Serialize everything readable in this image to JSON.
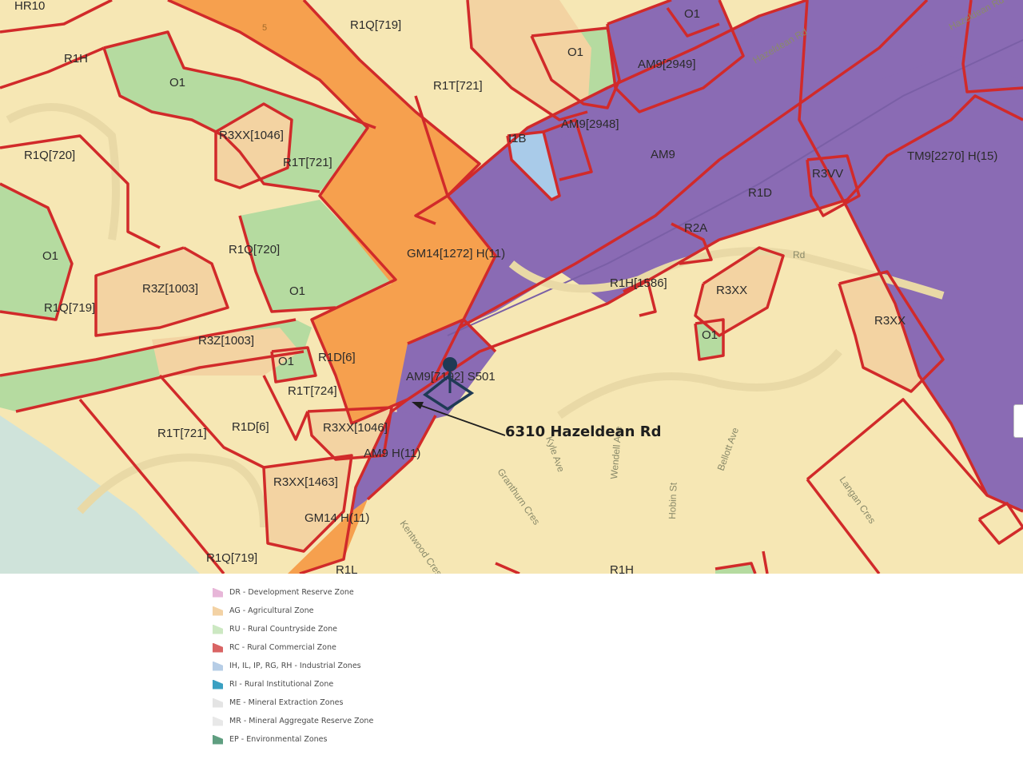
{
  "map": {
    "colors": {
      "residential": "#f6e7b4",
      "residential_light": "#f9efc6",
      "r3": "#f3d3a2",
      "open_space": "#b5dba0",
      "general_mixed": "#f6a04e",
      "arterial_mixed": "#8a6bb4",
      "industrial": "#a9cbe9",
      "boundary": "#d12a2a",
      "water": "#cfe3da"
    },
    "zone_labels": [
      "HR10",
      "R1H",
      "O1",
      "5",
      "R1Q[719]",
      "O1",
      "R1T[721]",
      "AM9[2949]",
      "O1",
      "R3XX[1046]",
      "R1Q[720]",
      "R1T[721]",
      "I1B",
      "AM9[2948]",
      "AM9",
      "TM9[2270] H(15)",
      "R3VV",
      "R1D",
      "R2A",
      "O1",
      "R1Q[720]",
      "GM14[1272] H(11)",
      "R3Z[1003]",
      "O1",
      "R1Q[719]",
      "R1H[1586]",
      "R3XX",
      "R3XX",
      "R3Z[1003]",
      "R1D[6]",
      "O1",
      "O1",
      "R1T[724]",
      "AM9[7192] S501",
      "R1T[721]",
      "R1D[6]",
      "R3XX[1046]",
      "AM9 H(11)",
      "R3XX[1463]",
      "GM14 H(11)",
      "R1Q[719]",
      "R1L",
      "R1H"
    ],
    "street_labels": [
      "Hazeldean Rd",
      "Hazeldean Rd",
      "Rd",
      "Bellott Ave",
      "Langan Cres",
      "Kyle Ave",
      "Wendell Ave",
      "Hobin St",
      "Granthurn Cres",
      "Kentwood Cres"
    ],
    "marker_icon": "map-pin-icon",
    "callout": "6310 Hazeldean Rd"
  },
  "legend": {
    "items": [
      {
        "label": "DR - Development Reserve Zone",
        "color": "#e7b6d8",
        "icon": "legend-swatch-icon"
      },
      {
        "label": "AG - Agricultural Zone",
        "color": "#f3d2a4",
        "icon": "legend-swatch-icon"
      },
      {
        "label": "RU - Rural Countryside Zone",
        "color": "#cce8c2",
        "icon": "legend-swatch-icon"
      },
      {
        "label": "RC - Rural Commercial Zone",
        "color": "#d96464",
        "icon": "legend-swatch-icon"
      },
      {
        "label": "IH, IL, IP, RG, RH - Industrial Zones",
        "color": "#b6cde6",
        "icon": "legend-swatch-icon"
      },
      {
        "label": "RI - Rural Institutional Zone",
        "color": "#3aa0c2",
        "icon": "legend-swatch-icon"
      },
      {
        "label": "ME - Mineral Extraction Zones",
        "color": "#e4e4e4",
        "icon": "legend-swatch-icon"
      },
      {
        "label": "MR - Mineral Aggregate Reserve Zone",
        "color": "#e8e8e8",
        "icon": "legend-swatch-icon"
      },
      {
        "label": "EP - Environmental Zones",
        "color": "#5f9e80",
        "icon": "legend-swatch-icon"
      }
    ]
  }
}
